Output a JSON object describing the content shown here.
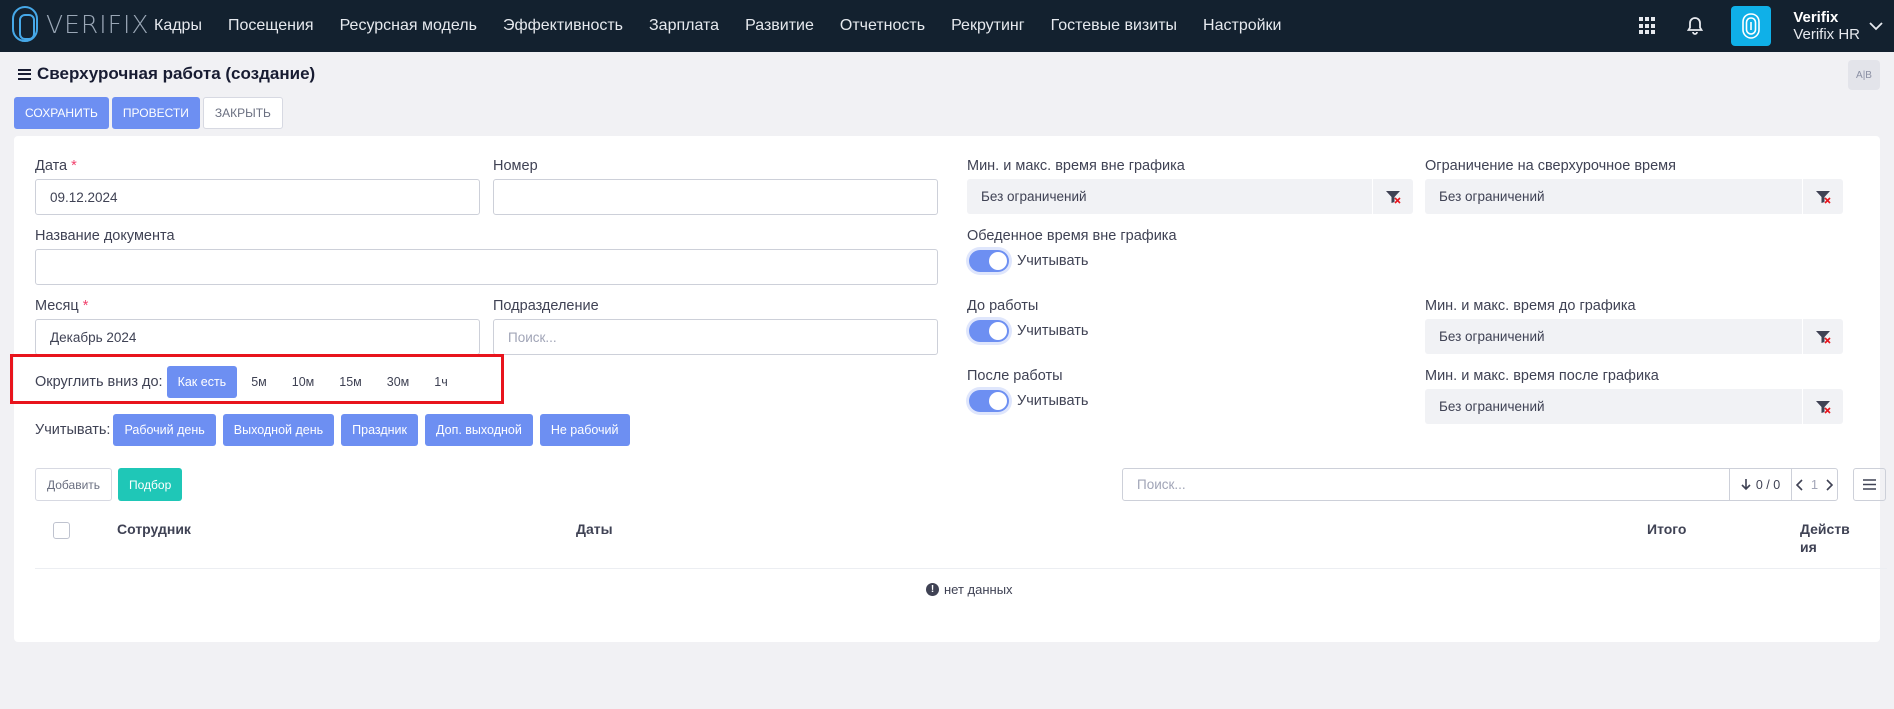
{
  "brand": {
    "logo_text": "VERIFIX"
  },
  "nav": {
    "items": [
      "Кадры",
      "Посещения",
      "Ресурсная модель",
      "Эффективность",
      "Зарплата",
      "Развитие",
      "Отчетность",
      "Рекрутинг",
      "Гостевые визиты",
      "Настройки"
    ]
  },
  "user": {
    "name": "Verifix",
    "company": "Verifix HR"
  },
  "page": {
    "title": "Сверхурочная работа (создание)",
    "lang_label": "A|B"
  },
  "toolbar": {
    "save": "СОХРАНИТЬ",
    "post": "ПРОВЕСТИ",
    "close": "ЗАКРЫТЬ"
  },
  "form": {
    "date_label": "Дата",
    "date_value": "09.12.2024",
    "required_mark": "*",
    "number_label": "Номер",
    "number_value": "",
    "docname_label": "Название документа",
    "docname_value": "",
    "month_label": "Месяц",
    "month_value": "Декабрь 2024",
    "division_label": "Подразделение",
    "division_placeholder": "Поиск...",
    "round_label": "Округлить вниз до:",
    "round_options": [
      "Как есть",
      "5м",
      "10м",
      "15м",
      "30м",
      "1ч"
    ],
    "round_selected": "Как есть",
    "count_label": "Учитывать:",
    "count_options": [
      "Рабочий день",
      "Выходной день",
      "Праздник",
      "Доп. выходной",
      "Не рабочий"
    ]
  },
  "right": {
    "outside_label": "Мин. и макс. время вне графика",
    "outside_value": "Без ограничений",
    "limit_label": "Ограничение на сверхурочное время",
    "limit_value": "Без ограничений",
    "lunch_label": "Обеденное время вне графика",
    "lunch_toggle": "Учитывать",
    "before_label": "До работы",
    "before_toggle": "Учитывать",
    "before_minmax_label": "Мин. и макс. время до графика",
    "before_minmax_value": "Без ограничений",
    "after_label": "После работы",
    "after_toggle": "Учитывать",
    "after_minmax_label": "Мин. и макс. время после графика",
    "after_minmax_value": "Без ограничений"
  },
  "table": {
    "add": "Добавить",
    "pick": "Подбор",
    "search_placeholder": "Поиск...",
    "count": "0 / 0",
    "page": "1",
    "columns": {
      "employee": "Сотрудник",
      "dates": "Даты",
      "total": "Итого",
      "actions": "Действия"
    },
    "empty": "нет данных"
  },
  "colors": {
    "primary": "#6d8ff2",
    "teal": "#1fc7b7",
    "topbar": "#13212f",
    "highlight": "#e8141d"
  }
}
